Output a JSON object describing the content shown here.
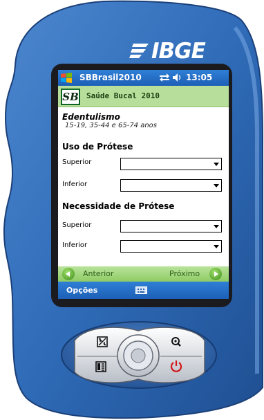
{
  "device": {
    "brand": "IBGE",
    "colors": {
      "shell": "#2f5f9f",
      "shell_light": "#5b93d6",
      "accent_green": "#b7de9a",
      "title_blue": "#1d5fb6"
    }
  },
  "status_bar": {
    "app_title": "SBBrasil2010",
    "time": "13:05",
    "icons": [
      "windows-start-icon",
      "network-icon",
      "speaker-icon"
    ]
  },
  "app_header": {
    "logo_text": "SB",
    "title": "Saúde Bucal 2010"
  },
  "form": {
    "section_title": "Edentulismo",
    "section_subtitle": "15-19, 35-44 e 65-74 anos",
    "groups": [
      {
        "title": "Uso de Prótese",
        "fields": [
          {
            "label": "Superior",
            "value": ""
          },
          {
            "label": "Inferior",
            "value": ""
          }
        ]
      },
      {
        "title": "Necessidade de Prótese",
        "fields": [
          {
            "label": "Superior",
            "value": ""
          },
          {
            "label": "Inferior",
            "value": ""
          }
        ]
      }
    ]
  },
  "navigation": {
    "prev_label": "Anterior",
    "next_label": "Próximo"
  },
  "menu": {
    "left_label": "Opções",
    "keyboard_icon": "keyboard-icon"
  },
  "hardware_buttons": [
    "apps-icon",
    "list-icon",
    "search-icon",
    "power-icon",
    "dpad"
  ]
}
